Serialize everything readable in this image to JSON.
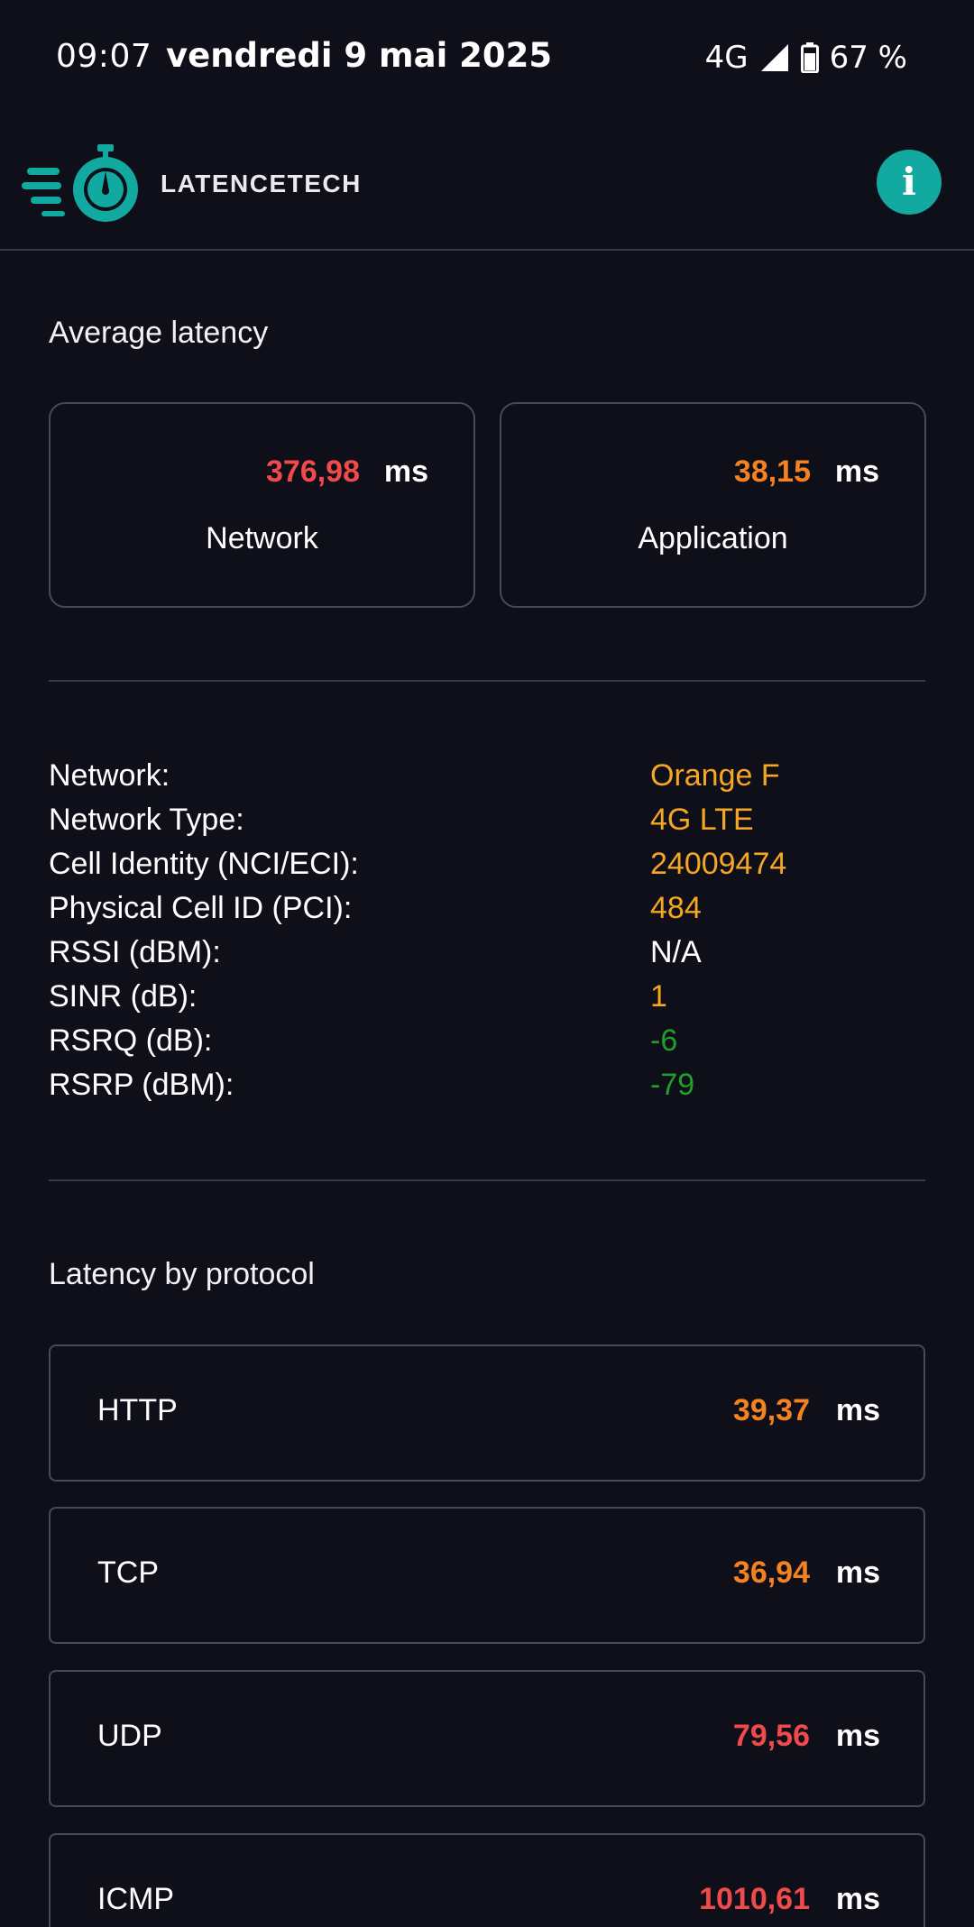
{
  "status_bar": {
    "time": "09:07",
    "date": "vendredi 9 mai 2025",
    "network": "4G",
    "battery": "67 %",
    "icons": [
      "signal-icon",
      "battery-icon"
    ]
  },
  "header": {
    "brand": "LATENCETECH",
    "info_label": "i",
    "colors": {
      "accent": "#12a9a0"
    }
  },
  "average_latency": {
    "title": "Average latency",
    "cards": [
      {
        "value": "376,98",
        "unit": "ms",
        "label": "Network",
        "color": "#f04a4a"
      },
      {
        "value": "38,15",
        "unit": "ms",
        "label": "Application",
        "color": "#f58220"
      }
    ]
  },
  "network_info": {
    "rows": [
      {
        "label": "Network:",
        "value": "Orange F",
        "color": "#f5a623"
      },
      {
        "label": "Network Type:",
        "value": "4G LTE",
        "color": "#f5a623"
      },
      {
        "label": "Cell Identity (NCI/ECI):",
        "value": "24009474",
        "color": "#f5a623"
      },
      {
        "label": "Physical Cell ID (PCI):",
        "value": "484",
        "color": "#f5a623"
      },
      {
        "label": "RSSI (dBM):",
        "value": "N/A",
        "color": "#ffffff"
      },
      {
        "label": "SINR (dB):",
        "value": "1",
        "color": "#f5a623"
      },
      {
        "label": "RSRQ (dB):",
        "value": "-6",
        "color": "#1f9e2a"
      },
      {
        "label": "RSRP (dBM):",
        "value": "-79",
        "color": "#1f9e2a"
      }
    ]
  },
  "protocols": {
    "title": "Latency by protocol",
    "items": [
      {
        "name": "HTTP",
        "value": "39,37",
        "unit": "ms",
        "color": "#f58220"
      },
      {
        "name": "TCP",
        "value": "36,94",
        "unit": "ms",
        "color": "#f58220"
      },
      {
        "name": "UDP",
        "value": "79,56",
        "unit": "ms",
        "color": "#f04a4a"
      },
      {
        "name": "ICMP",
        "value": "1010,61",
        "unit": "ms",
        "color": "#f04a4a"
      }
    ]
  }
}
